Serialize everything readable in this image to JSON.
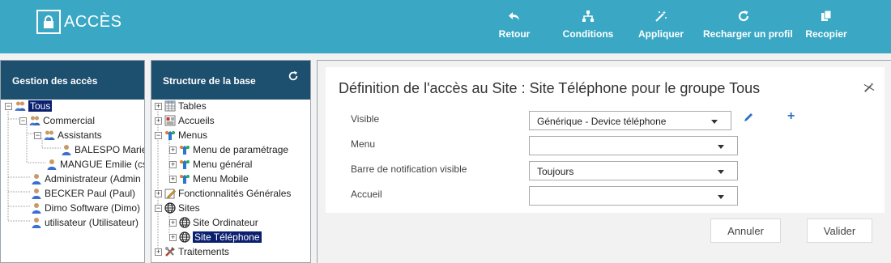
{
  "app": {
    "title": "ACCÈS",
    "icon": "lock-icon"
  },
  "toolbar": [
    {
      "label": "Retour",
      "icon": "undo-icon"
    },
    {
      "label": "Conditions",
      "icon": "hierarchy-icon"
    },
    {
      "label": "Appliquer",
      "icon": "magic-wand-icon"
    },
    {
      "label": "Recharger un profil",
      "icon": "refresh-icon"
    },
    {
      "label": "Recopier",
      "icon": "copy-icon"
    }
  ],
  "access_panel": {
    "title": "Gestion des accès",
    "tree": [
      {
        "label": "Tous",
        "icon": "group-icon",
        "selected": true
      },
      {
        "label": "Commercial",
        "icon": "group-icon"
      },
      {
        "label": "Assistants",
        "icon": "group-icon"
      },
      {
        "label": "BALESPO Marie",
        "icon": "user-icon"
      },
      {
        "label": "MANGUE Emilie (cs",
        "icon": "user-icon"
      },
      {
        "label": "Administrateur (Admin",
        "icon": "user-icon"
      },
      {
        "label": "BECKER Paul (Paul)",
        "icon": "user-icon"
      },
      {
        "label": "Dimo Software (Dimo)",
        "icon": "user-icon"
      },
      {
        "label": "utilisateur (Utilisateur)",
        "icon": "user-icon"
      }
    ]
  },
  "structure_panel": {
    "title": "Structure de la base",
    "tree": [
      {
        "label": "Tables",
        "icon": "table-icon"
      },
      {
        "label": "Accueils",
        "icon": "home-form-icon"
      },
      {
        "label": "Menus",
        "icon": "menu-tree-icon"
      },
      {
        "label": "Menu de paramétrage",
        "icon": "menu-tree-icon"
      },
      {
        "label": "Menu général",
        "icon": "menu-tree-icon"
      },
      {
        "label": "Menu Mobile",
        "icon": "menu-tree-icon"
      },
      {
        "label": "Fonctionnalités Générales",
        "icon": "pencil-doc-icon"
      },
      {
        "label": "Sites",
        "icon": "globe-icon"
      },
      {
        "label": "Site Ordinateur",
        "icon": "globe-icon"
      },
      {
        "label": "Site Téléphone",
        "icon": "globe-icon",
        "selected": true
      },
      {
        "label": "Traitements",
        "icon": "tools-icon"
      }
    ]
  },
  "detail": {
    "title": "Définition de l'accès au Site : Site Téléphone pour le groupe Tous",
    "fields": [
      {
        "label": "Visible",
        "value": "Générique - Device téléphone"
      },
      {
        "label": "Menu",
        "value": ""
      },
      {
        "label": "Barre de notification visible",
        "value": "Toujours"
      },
      {
        "label": "Accueil",
        "value": ""
      }
    ],
    "cancel_label": "Annuler",
    "validate_label": "Valider"
  },
  "colors": {
    "topbar": "#3aa8c4",
    "panel_header": "#1d4f6e",
    "selection": "#0a1f6e",
    "accent_blue": "#2f6fc9"
  }
}
